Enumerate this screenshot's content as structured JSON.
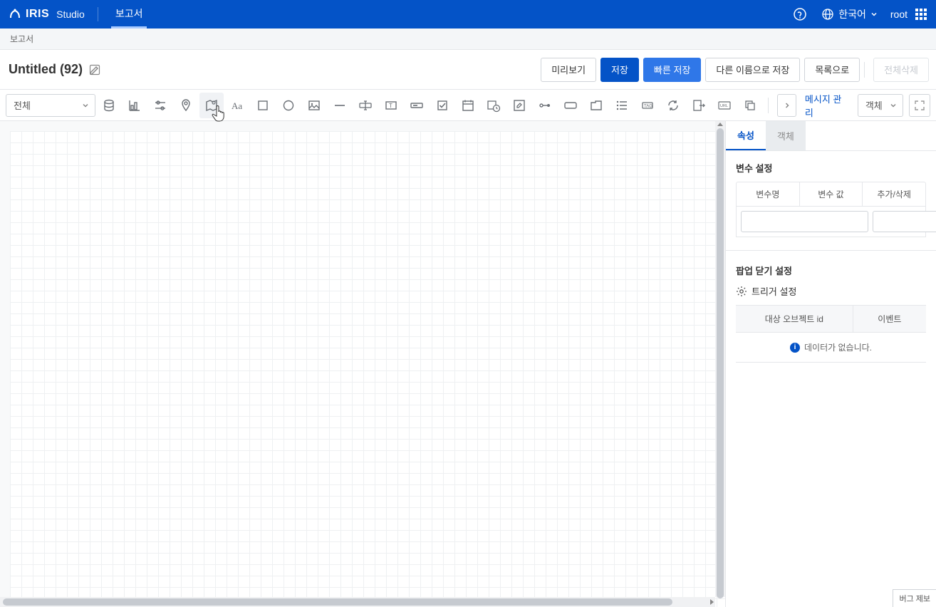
{
  "header": {
    "logo_brand": "IRIS",
    "logo_sub": "Studio",
    "tab_active": "보고서",
    "language": "한국어",
    "user": "root"
  },
  "breadcrumb": "보고서",
  "title": {
    "document": "Untitled (92)",
    "buttons": {
      "preview": "미리보기",
      "save": "저장",
      "quick_save": "빠른 저장",
      "save_as": "다른 이름으로 저장",
      "to_list": "목록으로",
      "delete_all": "전체삭제"
    }
  },
  "toolbar": {
    "filter_all": "전체",
    "message_manage": "메시지 관리",
    "object_select": "객체"
  },
  "side": {
    "tabs": {
      "properties": "속성",
      "objects": "객체"
    },
    "var_section": "변수 설정",
    "var_cols": {
      "name": "변수명",
      "value": "변수 값",
      "action": "추가/삭제"
    },
    "popup_section": "팝업 닫기 설정",
    "trigger_label": "트리거 설정",
    "trig_cols": {
      "target": "대상 오브젝트 id",
      "event": "이벤트"
    },
    "empty": "데이터가 없습니다."
  },
  "footer": {
    "bug": "버그 제보"
  }
}
